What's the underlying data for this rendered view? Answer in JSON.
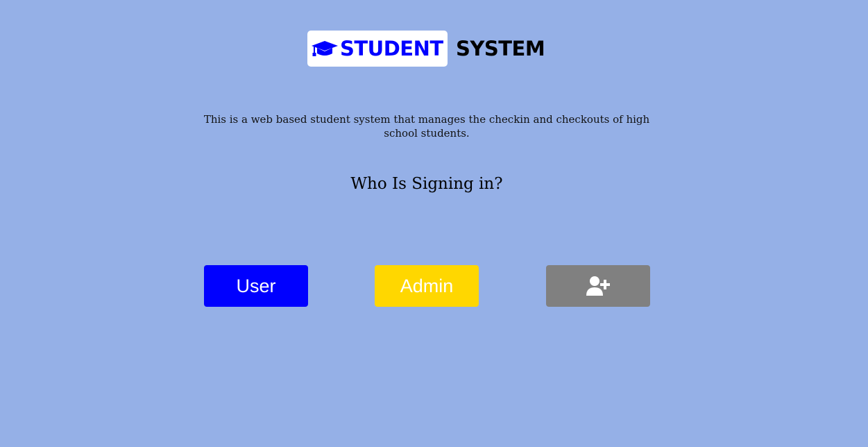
{
  "app": {
    "logo_word_1": "STUDENT",
    "logo_word_2": "SYSTEM",
    "logo_icon": "graduation-cap-icon"
  },
  "main": {
    "description": "This is a web based student system that manages the checkin and checkouts of high school students.",
    "heading": "Who Is Signing in?"
  },
  "buttons": {
    "user_label": "User",
    "admin_label": "Admin",
    "add_user_icon": "user-plus-icon"
  },
  "colors": {
    "background": "#95b0e7",
    "user_button": "#0000ff",
    "admin_button": "#ffd700",
    "add_user_button": "#808080",
    "logo_blue": "#0000ff"
  }
}
